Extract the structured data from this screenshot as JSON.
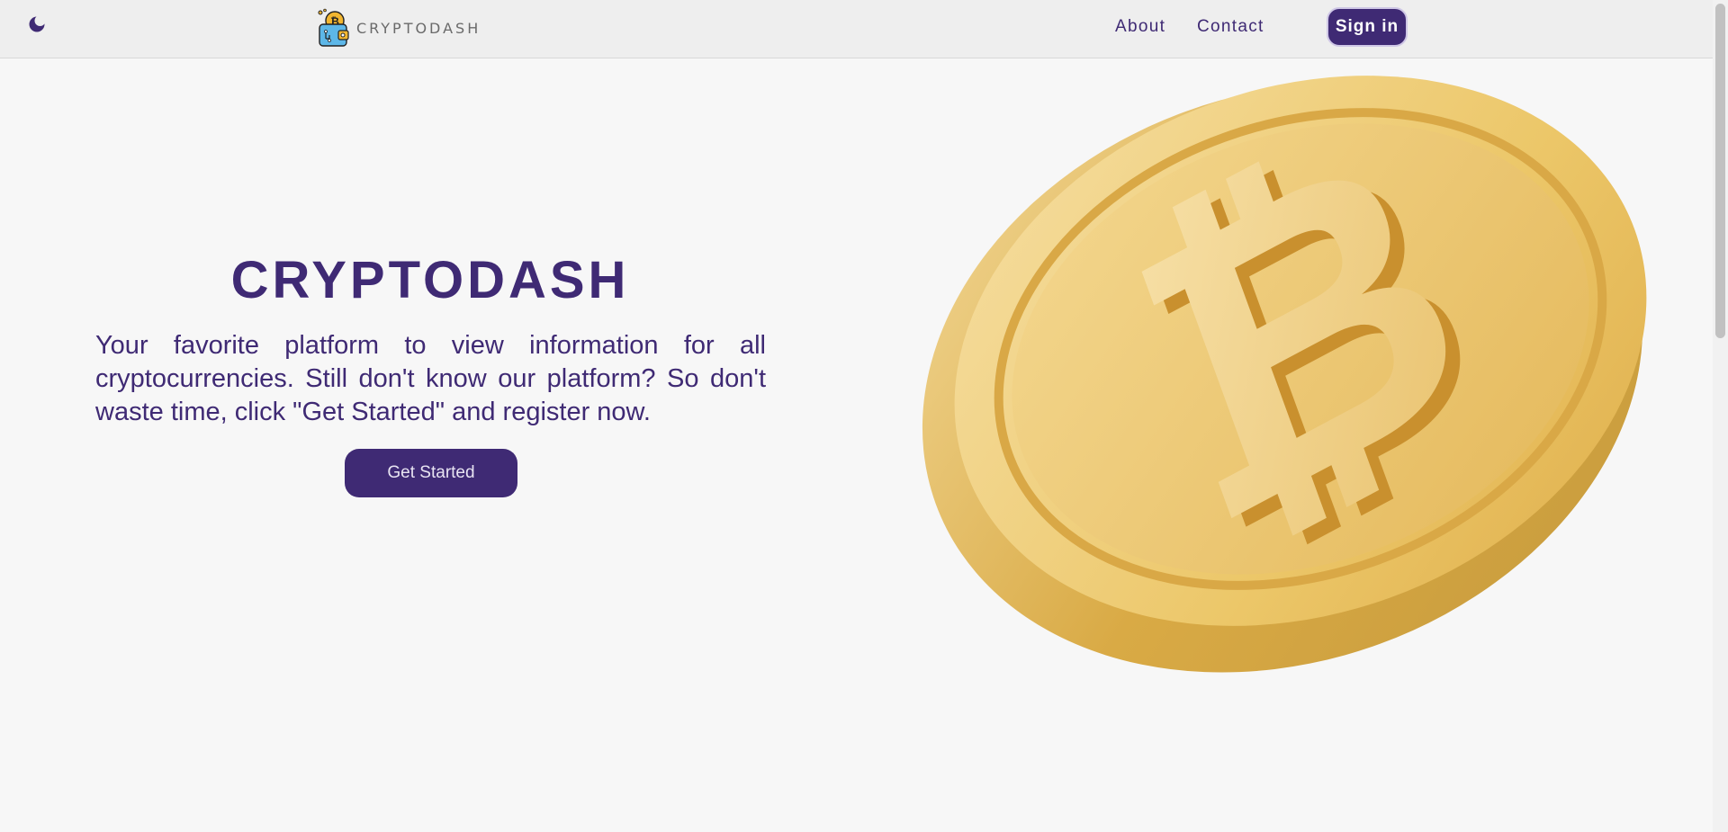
{
  "nav": {
    "logo_text": "CRYPTODASH",
    "about": "About",
    "contact": "Contact",
    "sign_in": "Sign in",
    "theme_icon": "moon-icon"
  },
  "hero": {
    "title": "CRYPTODASH",
    "description": "Your favorite platform to view information for all cryptocurrencies. Still don't know our platform? So don't waste time, click \"Get Started\" and register now.",
    "cta": "Get Started",
    "image_icon": "bitcoin-coin"
  },
  "colors": {
    "brand": "#3f2a74",
    "background": "#f7f7f7",
    "topbar": "#eeeeee",
    "coin_gold": "#e8bf5c"
  }
}
